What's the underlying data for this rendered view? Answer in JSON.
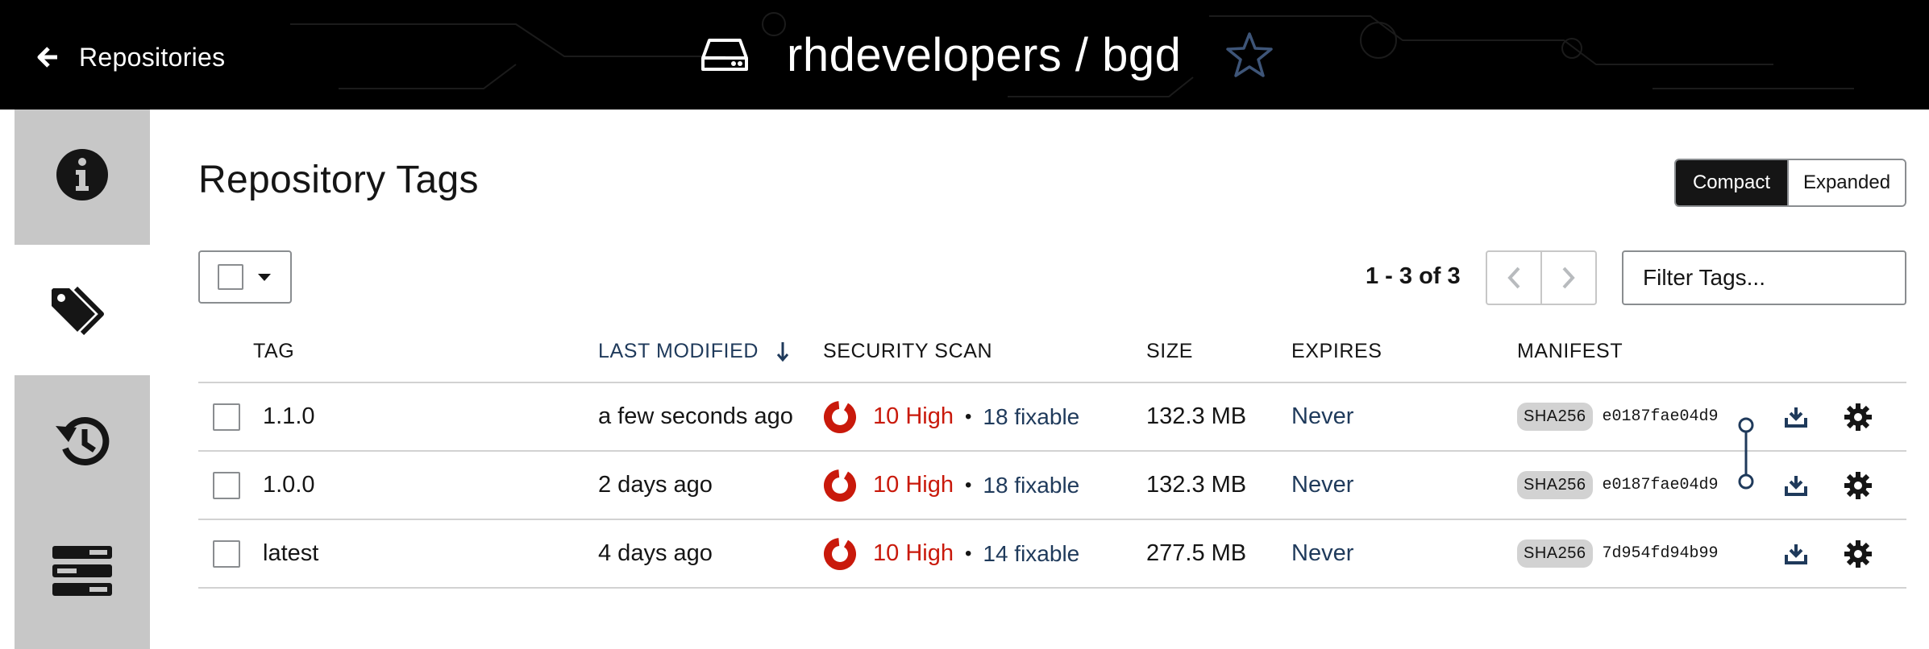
{
  "header": {
    "back_label": "Repositories",
    "repo_name": "rhdevelopers / bgd"
  },
  "side_tabs": [
    {
      "name": "info",
      "icon": "info-icon",
      "active": false
    },
    {
      "name": "tags",
      "icon": "tags-icon",
      "active": true
    },
    {
      "name": "history",
      "icon": "history-icon",
      "active": false
    },
    {
      "name": "builds",
      "icon": "builds-icon",
      "active": false
    }
  ],
  "page_title": "Repository Tags",
  "view_toggle": {
    "compact": "Compact",
    "expanded": "Expanded",
    "selected": "Compact"
  },
  "pagination": {
    "text": "1 - 3 of 3"
  },
  "filter": {
    "placeholder": "Filter Tags..."
  },
  "columns": {
    "tag": "TAG",
    "last_modified": "LAST MODIFIED",
    "security_scan": "SECURITY SCAN",
    "size": "SIZE",
    "expires": "EXPIRES",
    "manifest": "MANIFEST"
  },
  "rows": [
    {
      "tag": "1.1.0",
      "modified": "a few seconds ago",
      "severity": "10 High",
      "dot": "•",
      "fixable": "18 fixable",
      "size": "132.3 MB",
      "expires": "Never",
      "sha_label": "SHA256",
      "digest": "e0187fae04d9"
    },
    {
      "tag": "1.0.0",
      "modified": "2 days ago",
      "severity": "10 High",
      "dot": "•",
      "fixable": "18 fixable",
      "size": "132.3 MB",
      "expires": "Never",
      "sha_label": "SHA256",
      "digest": "e0187fae04d9"
    },
    {
      "tag": "latest",
      "modified": "4 days ago",
      "severity": "10 High",
      "dot": "•",
      "fixable": "14 fixable",
      "size": "277.5 MB",
      "expires": "Never",
      "sha_label": "SHA256",
      "digest": "7d954fd94b99"
    }
  ],
  "colors": {
    "header_bg": "#000000",
    "severity_red": "#c9190b",
    "link_blue": "#1f3a5b",
    "side_tab_bg": "#c7c7c7"
  }
}
